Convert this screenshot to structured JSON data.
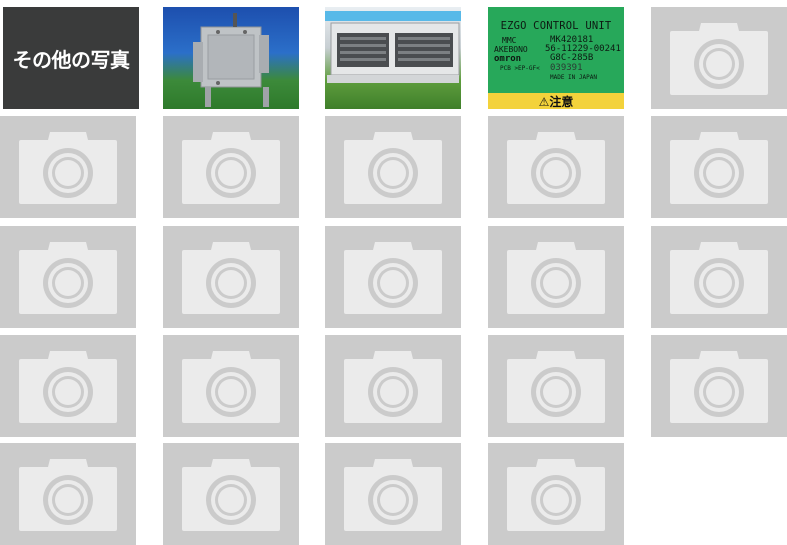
{
  "gallery": {
    "other_photos_label": "その他の写真",
    "placeholder_icon": "camera-icon",
    "colors": {
      "placeholder_bg": "#cbcbcb",
      "placeholder_icon": "#ebebeb",
      "label_bg": "#3a3b3b",
      "label_text": "#ffffff"
    },
    "label_photo": {
      "header": "EZGO CONTROL UNIT",
      "rows": [
        {
          "left": "MMC",
          "right": "MK420181"
        },
        {
          "left": "AKEBONO",
          "right": "56-11229-00241"
        },
        {
          "left": "omron",
          "right": "G8C-285B"
        },
        {
          "left": "PCB >EP-GF<",
          "right": "039391"
        }
      ],
      "made_in": "MADE IN JAPAN",
      "warning": "⚠注意"
    }
  }
}
